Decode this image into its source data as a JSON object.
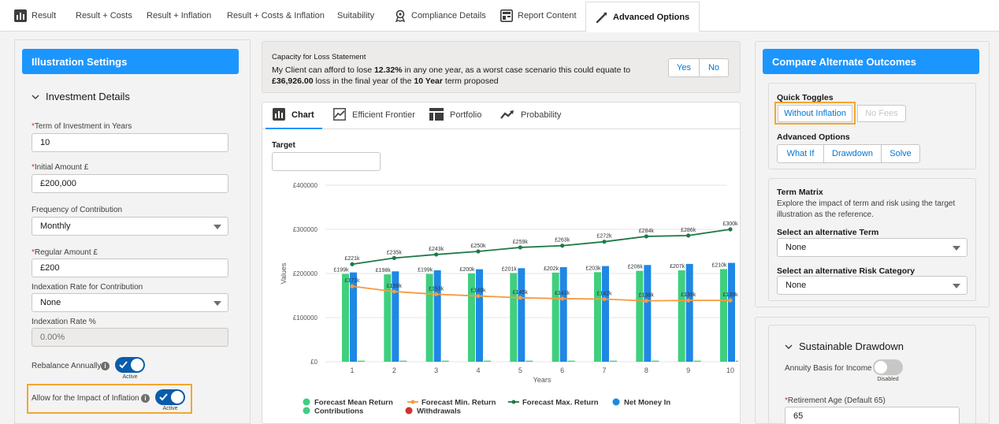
{
  "tabs": [
    {
      "label": "Result",
      "icon": "bar-chart-icon"
    },
    {
      "label": "Result + Costs"
    },
    {
      "label": "Result + Inflation"
    },
    {
      "label": "Result + Costs & Inflation"
    },
    {
      "label": "Suitability"
    },
    {
      "label": "Compliance Details",
      "icon": "award-icon"
    },
    {
      "label": "Report Content",
      "icon": "report-icon"
    },
    {
      "label": "Advanced Options",
      "icon": "wrench-icon",
      "active": true
    }
  ],
  "illustration": {
    "header": "Illustration Settings",
    "section": "Investment Details",
    "term_label": "Term of Investment in Years",
    "term_value": "10",
    "initial_label": "Initial Amount £",
    "initial_value": "£200,000",
    "frequency_label": "Frequency of Contribution",
    "frequency_value": "Monthly",
    "regular_label": "Regular Amount £",
    "regular_value": "£200",
    "indexation_label": "Indexation Rate for Contribution",
    "indexation_value": "None",
    "index_rate_label": "Indexation Rate %",
    "index_rate_value": "0.00%",
    "rebalance_label": "Rebalance Annually",
    "rebalance_status": "Active",
    "inflation_label": "Allow for the Impact of Inflation",
    "inflation_status": "Active"
  },
  "capacity": {
    "title": "Capacity for Loss Statement",
    "line1_a": "My Client can afford to lose ",
    "line1_b": "12.32%",
    "line1_c": " in any one year, as a worst case scenario this could equate to",
    "line2_a": "£36,926.00",
    "line2_b": " loss in the final year of the ",
    "line2_c": "10 Year",
    "line2_d": " term proposed",
    "yes": "Yes",
    "no": "No"
  },
  "chart_tabs": [
    {
      "label": "Chart",
      "icon": "bar-chart-icon",
      "active": true
    },
    {
      "label": "Efficient Frontier",
      "icon": "line-chart-icon"
    },
    {
      "label": "Portfolio",
      "icon": "table-icon"
    },
    {
      "label": "Probability",
      "icon": "trend-icon"
    }
  ],
  "target_label": "Target",
  "target_value": "",
  "chart_data": {
    "type": "bar",
    "xlabel": "Years",
    "ylabel": "Values",
    "ylim": [
      0,
      400000
    ],
    "yticks": [
      "£0",
      "£100000",
      "£200000",
      "£300000",
      "£400000"
    ],
    "categories": [
      "1",
      "2",
      "3",
      "4",
      "5",
      "6",
      "7",
      "8",
      "9",
      "10"
    ],
    "series": [
      {
        "name": "Forecast Mean Return",
        "type": "bar",
        "color": "#3fcf7f",
        "values": [
          199000,
          198000,
          199000,
          200000,
          201000,
          202000,
          203000,
          206000,
          207000,
          210000
        ],
        "labels": [
          "£199k",
          "£198k",
          "£199k",
          "£200k",
          "£201k",
          "£202k",
          "£203k",
          "£206k",
          "£207k",
          "£210k"
        ]
      },
      {
        "name": "Forecast Min. Return",
        "type": "line",
        "color": "#f79a3e",
        "values": [
          171000,
          159000,
          153000,
          149000,
          145000,
          143000,
          142000,
          138000,
          139000,
          139000
        ],
        "labels": [
          "£171k",
          "£159k",
          "£153k",
          "£149k",
          "£145k",
          "£143k",
          "£142k",
          "£138k",
          "£139k",
          "£139k"
        ]
      },
      {
        "name": "Forecast Max. Return",
        "type": "line",
        "color": "#1e7a45",
        "values": [
          221000,
          235000,
          243000,
          250000,
          259000,
          263000,
          272000,
          284000,
          286000,
          300000
        ],
        "labels": [
          "£221k",
          "£235k",
          "£243k",
          "£250k",
          "£259k",
          "£263k",
          "£272k",
          "£284k",
          "£286k",
          "£300k"
        ]
      },
      {
        "name": "Net Money In",
        "type": "bar",
        "color": "#1e88e5",
        "values": [
          202400,
          204800,
          207200,
          209600,
          212000,
          214400,
          216800,
          219200,
          221600,
          224000
        ]
      },
      {
        "name": "Contributions",
        "type": "bar",
        "color": "#3fcf7f",
        "values": [
          2400,
          2400,
          2400,
          2400,
          2400,
          2400,
          2400,
          2400,
          2400,
          2400
        ]
      },
      {
        "name": "Withdrawals",
        "type": "bar",
        "color": "#d0312d",
        "values": [
          0,
          0,
          0,
          0,
          0,
          0,
          0,
          0,
          0,
          0
        ]
      }
    ]
  },
  "compare": {
    "header": "Compare Alternate Outcomes",
    "quick_toggles": "Quick Toggles",
    "without_inflation": "Without Inflation",
    "no_fees": "No Fees",
    "advanced_options": "Advanced Options",
    "what_if": "What If",
    "drawdown": "Drawdown",
    "solve": "Solve"
  },
  "term_matrix": {
    "title": "Term Matrix",
    "desc": "Explore the impact of term and risk using the target illustration as the reference.",
    "alt_term_label": "Select an alternative Term",
    "alt_term_value": "None",
    "alt_risk_label": "Select an alternative Risk Category",
    "alt_risk_value": "None"
  },
  "drawdown": {
    "title": "Sustainable Drawdown",
    "annuity_label": "Annuity Basis for Income",
    "annuity_status": "Disabled",
    "retirement_label": "Retirement Age (Default 65)",
    "retirement_value": "65"
  }
}
